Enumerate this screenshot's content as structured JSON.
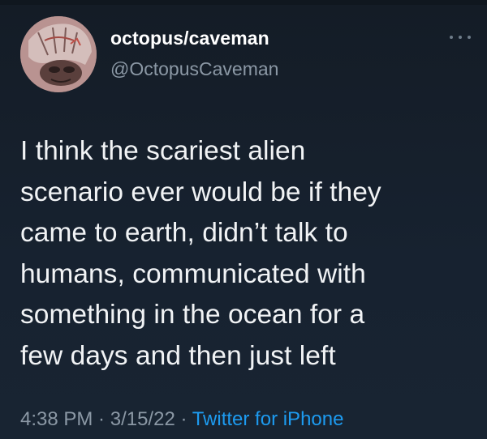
{
  "tweet": {
    "author": {
      "display_name": "octopus/caveman",
      "handle": "@OctopusCaveman",
      "avatar_icon": "avatar-painting-icon"
    },
    "more_icon": "ellipsis-icon",
    "text_lines": [
      "I think the scariest alien",
      "scenario ever would be if they",
      "came to earth, didn’t talk to",
      "humans, communicated with",
      "something in the ocean for a",
      "few days and then just left"
    ],
    "time": "4:38 PM",
    "separator": " · ",
    "date": "3/15/22",
    "source": "Twitter for iPhone"
  },
  "colors": {
    "background": "#15202b",
    "text": "#ffffff",
    "secondary": "#8b98a5",
    "accent": "#1d9bf0"
  }
}
